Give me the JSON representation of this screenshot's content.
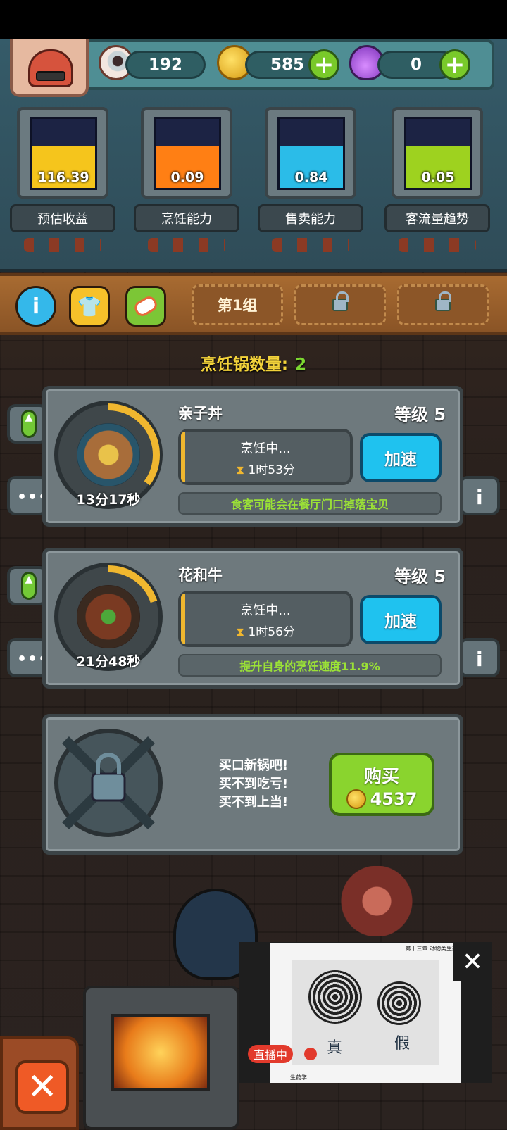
{
  "resources": {
    "eyes": "192",
    "coins": "585",
    "potions": "0"
  },
  "gauges": [
    {
      "value": "116.39",
      "label": "预估收益",
      "fill": 0.6,
      "color": "#f5c51c"
    },
    {
      "value": "0.09",
      "label": "烹饪能力",
      "fill": 0.6,
      "color": "#ff7f14"
    },
    {
      "value": "0.84",
      "label": "售卖能力",
      "fill": 0.6,
      "color": "#2bbce8"
    },
    {
      "value": "0.05",
      "label": "客流量趋势",
      "fill": 0.6,
      "color": "#9ed21f"
    }
  ],
  "toolbar": {
    "info_icon": "info-icon",
    "shirt_icon": "shirt-icon",
    "sushi_icon": "sushi-icon",
    "group_tab": "第1组"
  },
  "pot_count": {
    "label": "烹饪锅数量:",
    "value": "2"
  },
  "pots": [
    {
      "name": "亲子丼",
      "level": "等级 5",
      "timer": "13分17秒",
      "status": "烹饪中...",
      "time_left": "1时53分",
      "speed": "加速",
      "tip": "食客可能会在餐厅门口掉落宝贝",
      "progress": 0.35
    },
    {
      "name": "花和牛",
      "level": "等级 5",
      "timer": "21分48秒",
      "status": "烹饪中...",
      "time_left": "1时56分",
      "speed": "加速",
      "tip": "提升自身的烹饪速度11.9%",
      "progress": 0.2
    }
  ],
  "locked_pot": {
    "line1": "买口新锅吧!",
    "line2": "买不到吃亏!",
    "line3": "买不到上当!",
    "buy": "购买",
    "price": "4537"
  },
  "live": {
    "badge": "直播中",
    "close": "✕",
    "slide_header": "第十三章 动物类生药",
    "slide_footer": "生药学",
    "label_left": "真",
    "label_right": "假"
  },
  "close_label": "✕"
}
